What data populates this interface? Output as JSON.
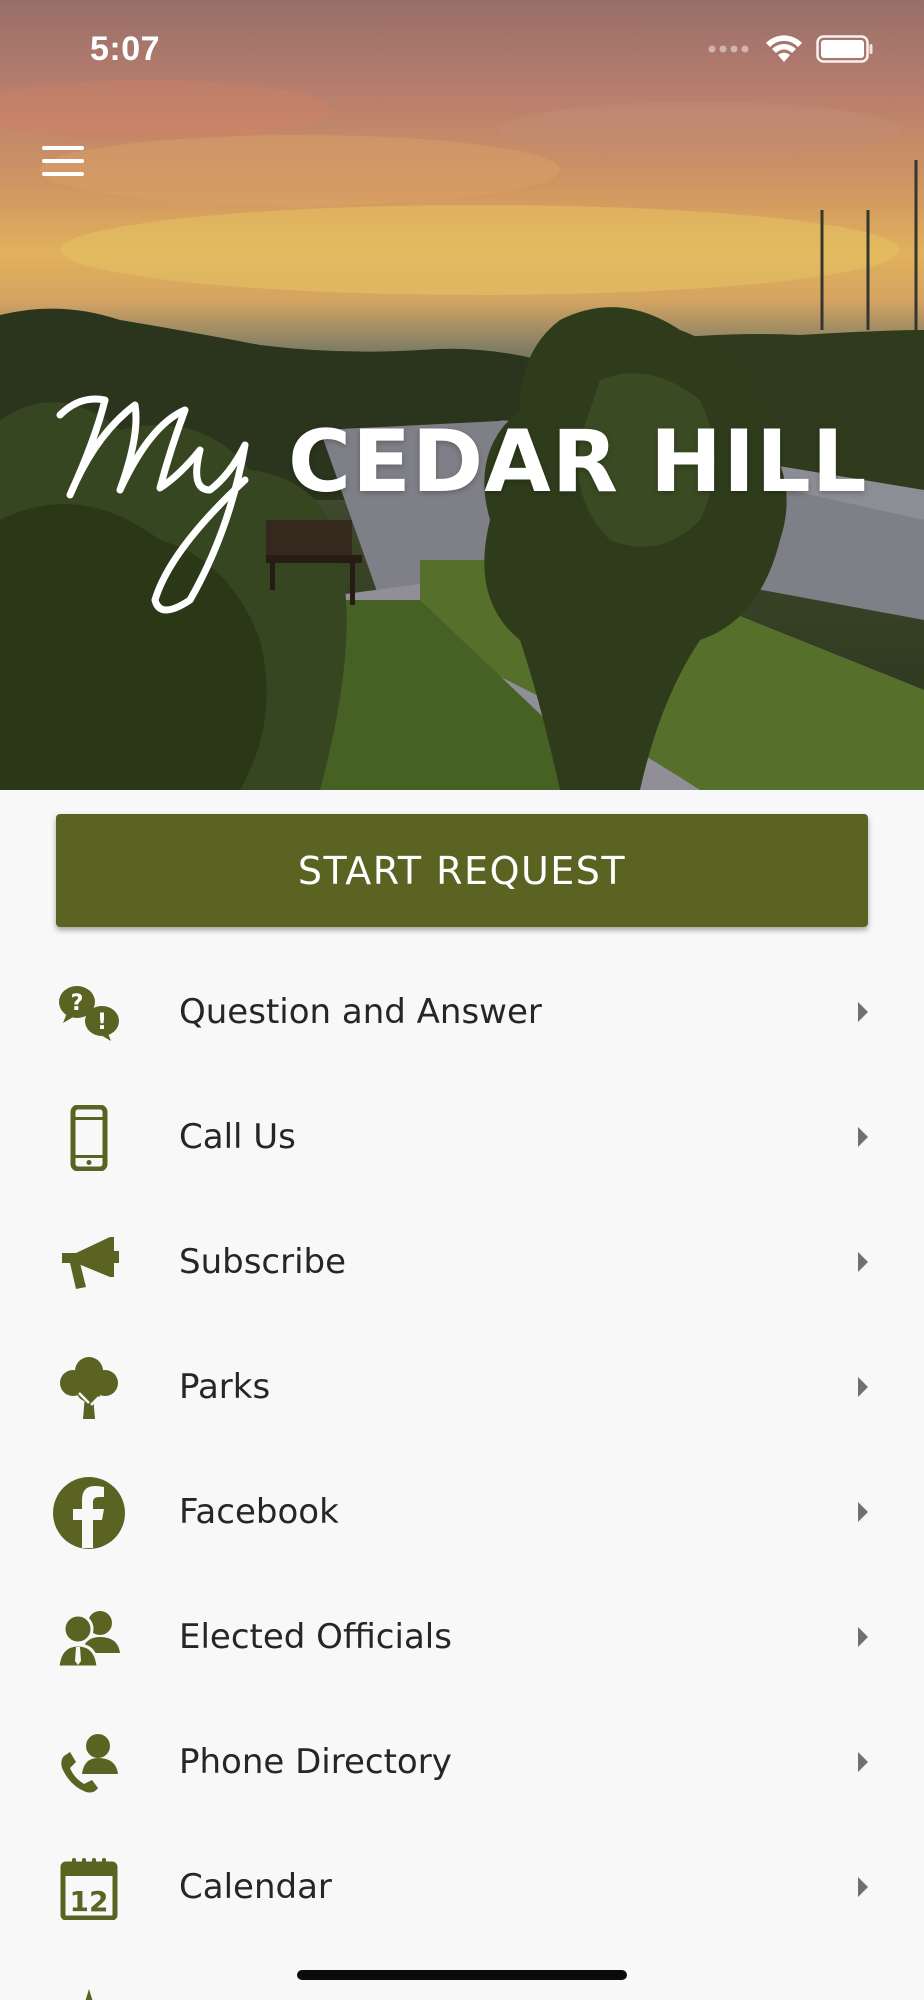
{
  "status_bar": {
    "time": "5:07"
  },
  "header": {
    "logo_script": "My",
    "logo_text": "CEDAR HILL"
  },
  "actions": {
    "start_request_label": "START REQUEST"
  },
  "menu": {
    "items": [
      {
        "label": "Question and Answer",
        "icon": "question-answer-icon"
      },
      {
        "label": "Call Us",
        "icon": "mobile-phone-icon"
      },
      {
        "label": "Subscribe",
        "icon": "megaphone-icon"
      },
      {
        "label": "Parks",
        "icon": "tree-icon"
      },
      {
        "label": "Facebook",
        "icon": "facebook-icon"
      },
      {
        "label": "Elected Officials",
        "icon": "officials-icon"
      },
      {
        "label": "Phone Directory",
        "icon": "phone-directory-icon"
      },
      {
        "label": "Calendar",
        "icon": "calendar-icon",
        "day": "12"
      }
    ]
  },
  "colors": {
    "accent": "#5b6322",
    "text": "#262626",
    "background": "#f8f8f8"
  }
}
